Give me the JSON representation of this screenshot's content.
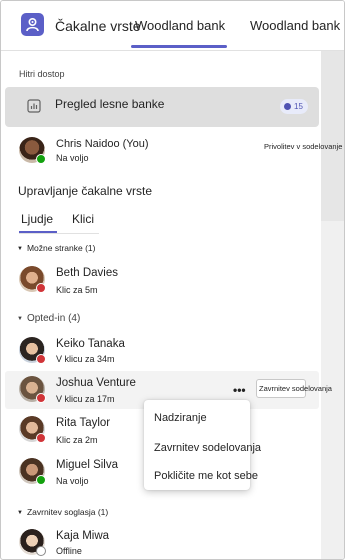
{
  "header": {
    "app_title": "Čakalne vrste",
    "tabs": [
      {
        "label": "Woodland bank",
        "active": true
      },
      {
        "label": "Woodland bank s",
        "active": false
      }
    ]
  },
  "quick_access": {
    "label": "Hitri dostop",
    "item_label": "Pregled lesne banke",
    "badge_count": "15"
  },
  "me": {
    "name": "Chris Naidoo (You)",
    "status": "Na voljo",
    "action": "Privolitev v sodelovanje"
  },
  "queue_management": {
    "heading": "Upravljanje čakalne vrste",
    "tabs": [
      "Ljudje",
      "Klici"
    ]
  },
  "groups": [
    {
      "label": "Možne stranke (1)",
      "people": [
        {
          "name": "Beth Davies",
          "status": "Klic za 5m",
          "presence": "red"
        }
      ]
    },
    {
      "label": "Opted-in (4)",
      "people": [
        {
          "name": "Keiko Tanaka",
          "status": "V klicu za 34m",
          "presence": "red"
        },
        {
          "name": "Joshua Venture",
          "status": "V klicu za 17m",
          "presence": "red"
        },
        {
          "name": "Rita Taylor",
          "status": "Klic za 2m",
          "presence": "red"
        },
        {
          "name": "Miguel Silva",
          "status": "Na voljo",
          "presence": "green"
        }
      ]
    },
    {
      "label": "Zavrnitev soglasja (1)",
      "people": [
        {
          "name": "Kaja Miwa",
          "status": "Offline",
          "presence": "gray"
        }
      ]
    }
  ],
  "row_actions": {
    "more": "•••",
    "end_button": "Zavrnitev sodelovanja"
  },
  "context_menu": {
    "items": [
      "Nadziranje",
      "Zavrnitev sodelovanja",
      "Pokličite me kot sebe"
    ]
  },
  "colors": {
    "accent": "#5b5fc7",
    "available": "#13a10e",
    "busy": "#d13438"
  }
}
